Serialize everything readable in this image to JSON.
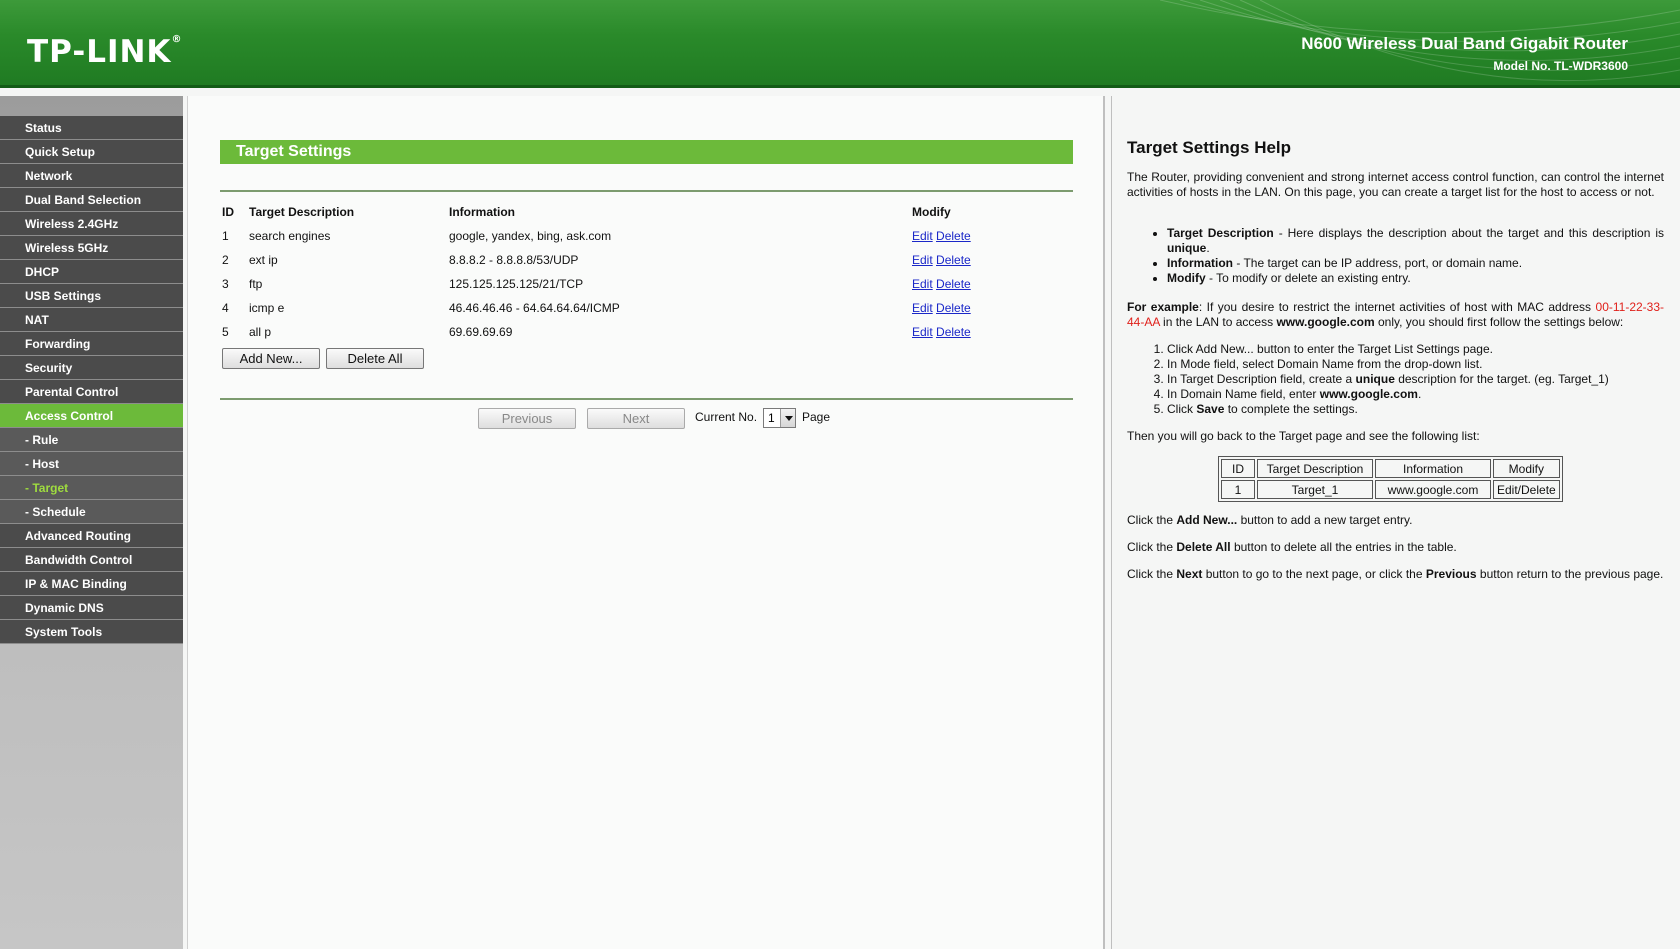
{
  "header": {
    "logo": "TP-LINK",
    "logo_mark": "®",
    "product": "N600 Wireless Dual Band Gigabit Router",
    "model": "Model No. TL-WDR3600"
  },
  "menu": {
    "items": [
      {
        "label": "Status"
      },
      {
        "label": "Quick Setup"
      },
      {
        "label": "Network"
      },
      {
        "label": "Dual Band Selection"
      },
      {
        "label": "Wireless 2.4GHz"
      },
      {
        "label": "Wireless 5GHz"
      },
      {
        "label": "DHCP"
      },
      {
        "label": "USB Settings"
      },
      {
        "label": "NAT"
      },
      {
        "label": "Forwarding"
      },
      {
        "label": "Security"
      },
      {
        "label": "Parental Control"
      },
      {
        "label": "Access Control"
      },
      {
        "label": "- Rule"
      },
      {
        "label": "- Host"
      },
      {
        "label": "- Target"
      },
      {
        "label": "- Schedule"
      },
      {
        "label": "Advanced Routing"
      },
      {
        "label": "Bandwidth Control"
      },
      {
        "label": "IP & MAC Binding"
      },
      {
        "label": "Dynamic DNS"
      },
      {
        "label": "System Tools"
      }
    ]
  },
  "main": {
    "title": "Target Settings",
    "columns": [
      "ID",
      "Target Description",
      "Information",
      "Modify"
    ],
    "rows": [
      {
        "id": "1",
        "desc": "search engines",
        "info": "google, yandex, bing, ask.com",
        "edit": "Edit",
        "delete": "Delete"
      },
      {
        "id": "2",
        "desc": "ext ip",
        "info": "8.8.8.2 - 8.8.8.8/53/UDP",
        "edit": "Edit",
        "delete": "Delete"
      },
      {
        "id": "3",
        "desc": "ftp",
        "info": "125.125.125.125/21/TCP",
        "edit": "Edit",
        "delete": "Delete"
      },
      {
        "id": "4",
        "desc": "icmp e",
        "info": "46.46.46.46 - 64.64.64.64/ICMP",
        "edit": "Edit",
        "delete": "Delete"
      },
      {
        "id": "5",
        "desc": "all p",
        "info": "69.69.69.69",
        "edit": "Edit",
        "delete": "Delete"
      }
    ],
    "add_new": "Add New...",
    "delete_all": "Delete All",
    "previous": "Previous",
    "next": "Next",
    "current_no_label": "Current No.",
    "current_no_value": "1",
    "page_label": "Page"
  },
  "help": {
    "title": "Target Settings Help",
    "intro": "The Router, providing convenient and strong internet access control function, can control the internet activities of hosts in the LAN. On this page, you can create a target list for the host to access or not.",
    "bullets": [
      {
        "term": "Target Description",
        "text": " - Here displays the description about the target and this description is ",
        "strong": "unique",
        "end": "."
      },
      {
        "term": "Information",
        "text": " - The target can be IP address, port, or domain name."
      },
      {
        "term": "Modify",
        "text": " - To modify or delete an existing entry."
      }
    ],
    "example": {
      "label": "For example",
      "text1": ": If you desire to restrict the internet activities of host with MAC address ",
      "mac": "00-11-22-33-44-AA",
      "text2": " in the LAN to access ",
      "domain": "www.google.com",
      "text3": " only, you should first follow the settings below:"
    },
    "steps": {
      "s1": "Click Add New... button to enter the Target List Settings page.",
      "s2": "In Mode field, select Domain Name from the drop-down list.",
      "s3a": "In Target Description field, create a ",
      "s3b": "unique",
      "s3c": " description for the target. (eg. Target_1)",
      "s4a": "In Domain Name field, enter ",
      "s4b": "www.google.com",
      "s4c": ".",
      "s5a": "Click ",
      "s5b": "Save",
      "s5c": " to complete the settings."
    },
    "then": "Then you will go back to the Target page and see the following list:",
    "demo": {
      "headers": [
        "ID",
        "Target Description",
        "Information",
        "Modify"
      ],
      "row": [
        "1",
        "Target_1",
        "www.google.com",
        "Edit/Delete"
      ]
    },
    "add_a": "Click the ",
    "add_b": "Add New...",
    "add_c": " button to add a new target entry.",
    "del_a": "Click the ",
    "del_b": "Delete All",
    "del_c": " button to delete all the entries in the table.",
    "next_a": "Click the ",
    "next_b": "Next",
    "next_c": " button to go to the next page, or click the ",
    "next_d": "Previous",
    "next_e": " button return to the previous page."
  }
}
